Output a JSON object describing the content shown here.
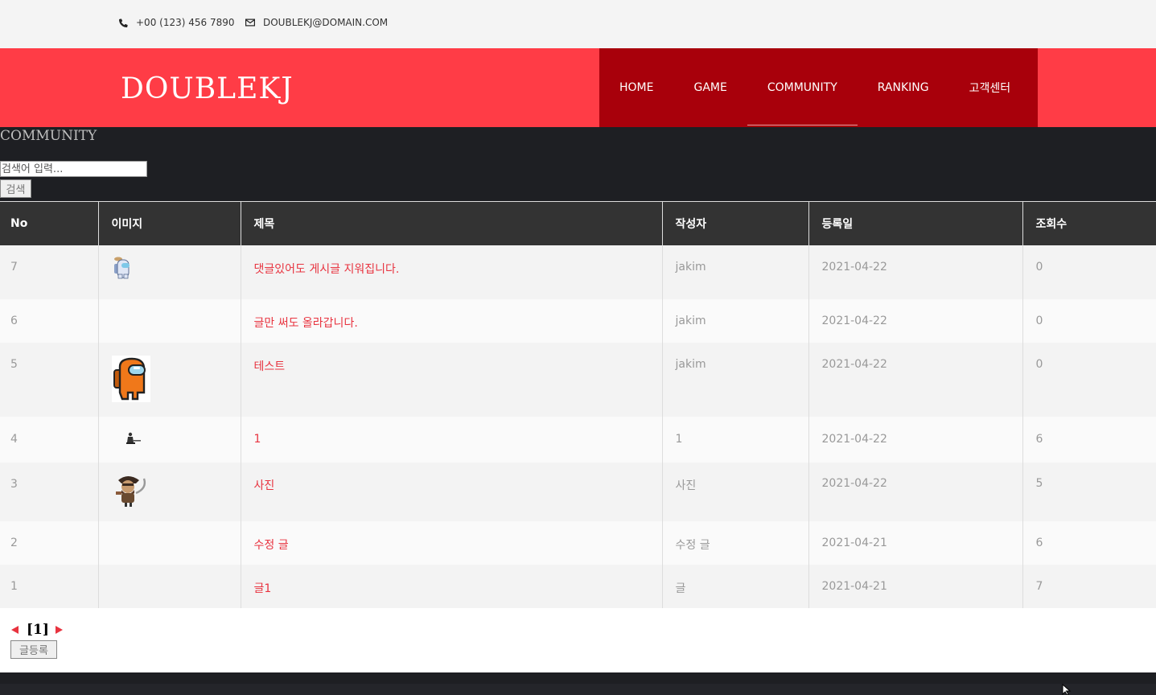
{
  "topbar": {
    "phone": "+00 (123) 456 7890",
    "email": "DOUBLEKJ@DOMAIN.COM",
    "phone_icon": "phone-icon",
    "email_icon": "envelope-icon"
  },
  "header": {
    "logo": "DOUBLEKJ",
    "nav": [
      "HOME",
      "GAME",
      "COMMUNITY",
      "RANKING",
      "고객센터"
    ],
    "active": "COMMUNITY"
  },
  "colors": {
    "header_bg": "#ff3c46",
    "nav_bg": "#a8000b",
    "dark_bg": "#1e1f23",
    "table_header_bg": "#333333",
    "link": "#e8333f"
  },
  "section": {
    "title": "COMMUNITY",
    "search_placeholder": "검색어 입력...",
    "search_button": "검색"
  },
  "table": {
    "columns": [
      "No",
      "이미지",
      "제목",
      "작성자",
      "등록일",
      "조회수"
    ],
    "rows": [
      {
        "no": "7",
        "image": "white-crewmate-image",
        "title": "댓글있어도 게시글 지워집니다.",
        "author": "jakim",
        "date": "2021-04-22",
        "views": "0"
      },
      {
        "no": "6",
        "image": "",
        "title": "글만 써도 올라갑니다.",
        "author": "jakim",
        "date": "2021-04-22",
        "views": "0"
      },
      {
        "no": "5",
        "image": "orange-crewmate-image",
        "title": "테스트",
        "author": "jakim",
        "date": "2021-04-22",
        "views": "0"
      },
      {
        "no": "4",
        "image": "small-figure-image",
        "title": "1",
        "author": "1",
        "date": "2021-04-22",
        "views": "6"
      },
      {
        "no": "3",
        "image": "pirate-character-image",
        "title": "사진",
        "author": "사진",
        "date": "2021-04-22",
        "views": "5"
      },
      {
        "no": "2",
        "image": "",
        "title": "수정 글",
        "author": "수정 글",
        "date": "2021-04-21",
        "views": "6"
      },
      {
        "no": "1",
        "image": "",
        "title": "글1",
        "author": "글",
        "date": "2021-04-21",
        "views": "7"
      }
    ]
  },
  "pagination": {
    "current": "[1]",
    "prev_icon": "triangle-left-icon",
    "next_icon": "triangle-right-icon"
  },
  "write_button": "글등록"
}
